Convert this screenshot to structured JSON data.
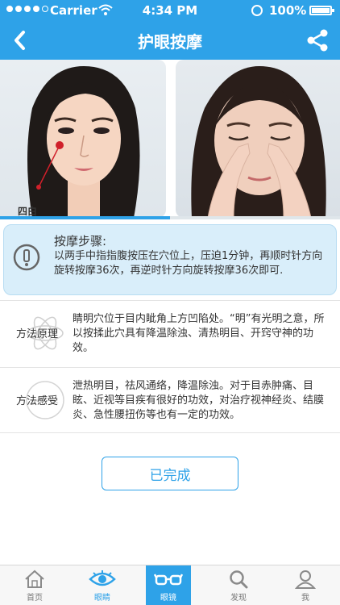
{
  "status_bar": {
    "carrier": "Carrier",
    "time": "4:34 PM",
    "battery": "100%"
  },
  "nav": {
    "title": "护眼按摩",
    "back_icon": "back-chevron-icon",
    "share_icon": "share-icon"
  },
  "photos": {
    "left_point_label": "四白",
    "progress_fraction": 0.5
  },
  "steps": {
    "title": "按摩步骤:",
    "text": "以两手中指指腹按压在穴位上，压迫1分钟，再顺时针方向旋转按摩36次，再逆时针方向旋转按摩36次即可."
  },
  "methods": [
    {
      "label": "方法原理",
      "text": "睛明穴位于目内眦角上方凹陷处。“明”有光明之意，所以按揉此穴具有降温除浊、清热明目、开窍守神的功效。"
    },
    {
      "label": "方法感受",
      "text": "泄热明目，祛风通络，降温除浊。对于目赤肿痛、目眩、近视等目疾有很好的功效，对治疗视神经炎、结膜炎、急性腰扭伤等也有一定的功效。"
    }
  ],
  "done_button": "已完成",
  "tabs": [
    {
      "label": "首页",
      "icon": "home-icon"
    },
    {
      "label": "眼睛",
      "icon": "eye-icon"
    },
    {
      "label": "眼镜",
      "icon": "glasses-icon"
    },
    {
      "label": "发现",
      "icon": "search-icon"
    },
    {
      "label": "我",
      "icon": "person-icon"
    }
  ],
  "colors": {
    "primary": "#2ea2e8",
    "steps_bg": "#d9eefa"
  }
}
